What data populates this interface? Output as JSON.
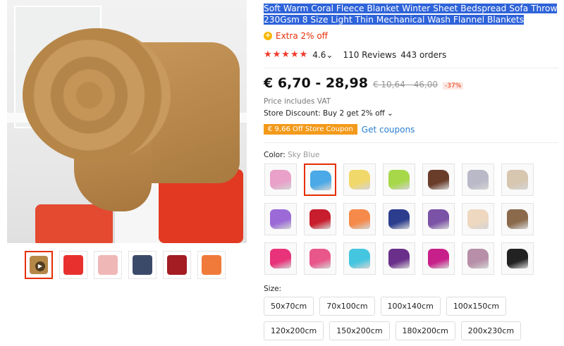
{
  "product": {
    "title": "Soft Warm Coral Fleece Blanket Winter Sheet Bedspread Sofa Throw 230Gsm 8 Size Light Thin Mechanical Wash Flannel Blankets",
    "extra_discount": "Extra 2% off",
    "rating_stars": "★★★★★",
    "rating_value": "4.6",
    "rating_chevron": "⌄",
    "reviews": "110 Reviews",
    "orders": "443 orders",
    "price_range": "€ 6,70 - 28,98",
    "original_price": "€ 10,64 - 46,00",
    "discount_percent": "-37%",
    "vat_note": "Price includes VAT",
    "store_discount": "Store Discount: Buy 2 get 2% off ⌄",
    "coupon_tag": "€ 9,66 Off Store Coupon",
    "get_coupons": "Get coupons",
    "color_label": "Color:",
    "color_selected": "Sky Blue",
    "size_label": "Size:",
    "sizes": [
      "50x70cm",
      "70x100cm",
      "100x140cm",
      "100x150cm",
      "120x200cm",
      "150x200cm",
      "180x200cm",
      "200x230cm"
    ]
  },
  "colors": {
    "accent": "#e62e04",
    "link": "#2a7fd1",
    "selection": "#2e63d9",
    "coupon": "#f39a1b"
  },
  "gallery": {
    "thumb_colors": [
      "#b58848",
      "#e8312f",
      "#f0b7b7",
      "#3c4a6a",
      "#a31d22",
      "#f07a3a"
    ]
  },
  "swatch_colors": [
    "#e9a0c9",
    "#4aa9e6",
    "#f1d86a",
    "#a7d84a",
    "#6a3c2a",
    "#b9b9c8",
    "#d7c6b0",
    "#9b6ad6",
    "#c81d2c",
    "#f58a4a",
    "#2c3d8e",
    "#7a52a6",
    "#efd8c0",
    "#8b6a4c",
    "#e8327a",
    "#e8568a",
    "#45c6e0",
    "#6a2f8a",
    "#c8208a",
    "#b78fa8",
    "#222222"
  ]
}
